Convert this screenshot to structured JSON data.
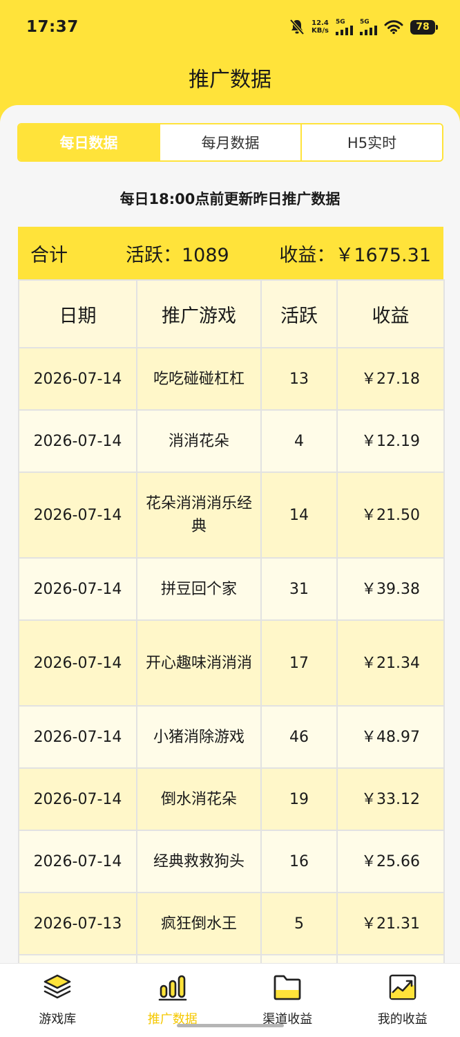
{
  "status": {
    "time": "17:37",
    "net_speed_value": "12.4",
    "net_speed_unit": "KB/s",
    "sim1": "5G",
    "sim2": "5G",
    "battery": "78"
  },
  "header": {
    "title": "推广数据"
  },
  "tabs": [
    {
      "label": "每日数据",
      "active": true
    },
    {
      "label": "每月数据",
      "active": false
    },
    {
      "label": "H5实时",
      "active": false
    }
  ],
  "notice": "每日18:00点前更新昨日推广数据",
  "summary": {
    "total_label": "合计",
    "active_text": "活跃：1089",
    "income_text": "收益：￥1675.31"
  },
  "table": {
    "headers": [
      "日期",
      "推广游戏",
      "活跃",
      "收益"
    ],
    "rows": [
      {
        "date": "2026-07-14",
        "game": "吃吃碰碰杠杠",
        "active": "13",
        "income": "￥27.18"
      },
      {
        "date": "2026-07-14",
        "game": "消消花朵",
        "active": "4",
        "income": "￥12.19"
      },
      {
        "date": "2026-07-14",
        "game": "花朵消消消乐经典",
        "active": "14",
        "income": "￥21.50"
      },
      {
        "date": "2026-07-14",
        "game": "拼豆回个家",
        "active": "31",
        "income": "￥39.38"
      },
      {
        "date": "2026-07-14",
        "game": "开心趣味消消消",
        "active": "17",
        "income": "￥21.34"
      },
      {
        "date": "2026-07-14",
        "game": "小猪消除游戏",
        "active": "46",
        "income": "￥48.97"
      },
      {
        "date": "2026-07-14",
        "game": "倒水消花朵",
        "active": "19",
        "income": "￥33.12"
      },
      {
        "date": "2026-07-14",
        "game": "经典救救狗头",
        "active": "16",
        "income": "￥25.66"
      },
      {
        "date": "2026-07-13",
        "game": "疯狂倒水王",
        "active": "5",
        "income": "￥21.31"
      },
      {
        "date": "",
        "game": "",
        "active": "",
        "income": ""
      }
    ]
  },
  "nav": [
    {
      "label": "游戏库",
      "icon": "layers-icon",
      "active": false
    },
    {
      "label": "推广数据",
      "icon": "bar-chart-icon",
      "active": true
    },
    {
      "label": "渠道收益",
      "icon": "folder-icon",
      "active": false
    },
    {
      "label": "我的收益",
      "icon": "trend-chart-icon",
      "active": false
    }
  ],
  "colors": {
    "brand_yellow": "#FFE33A",
    "active_nav": "#F5C800"
  }
}
